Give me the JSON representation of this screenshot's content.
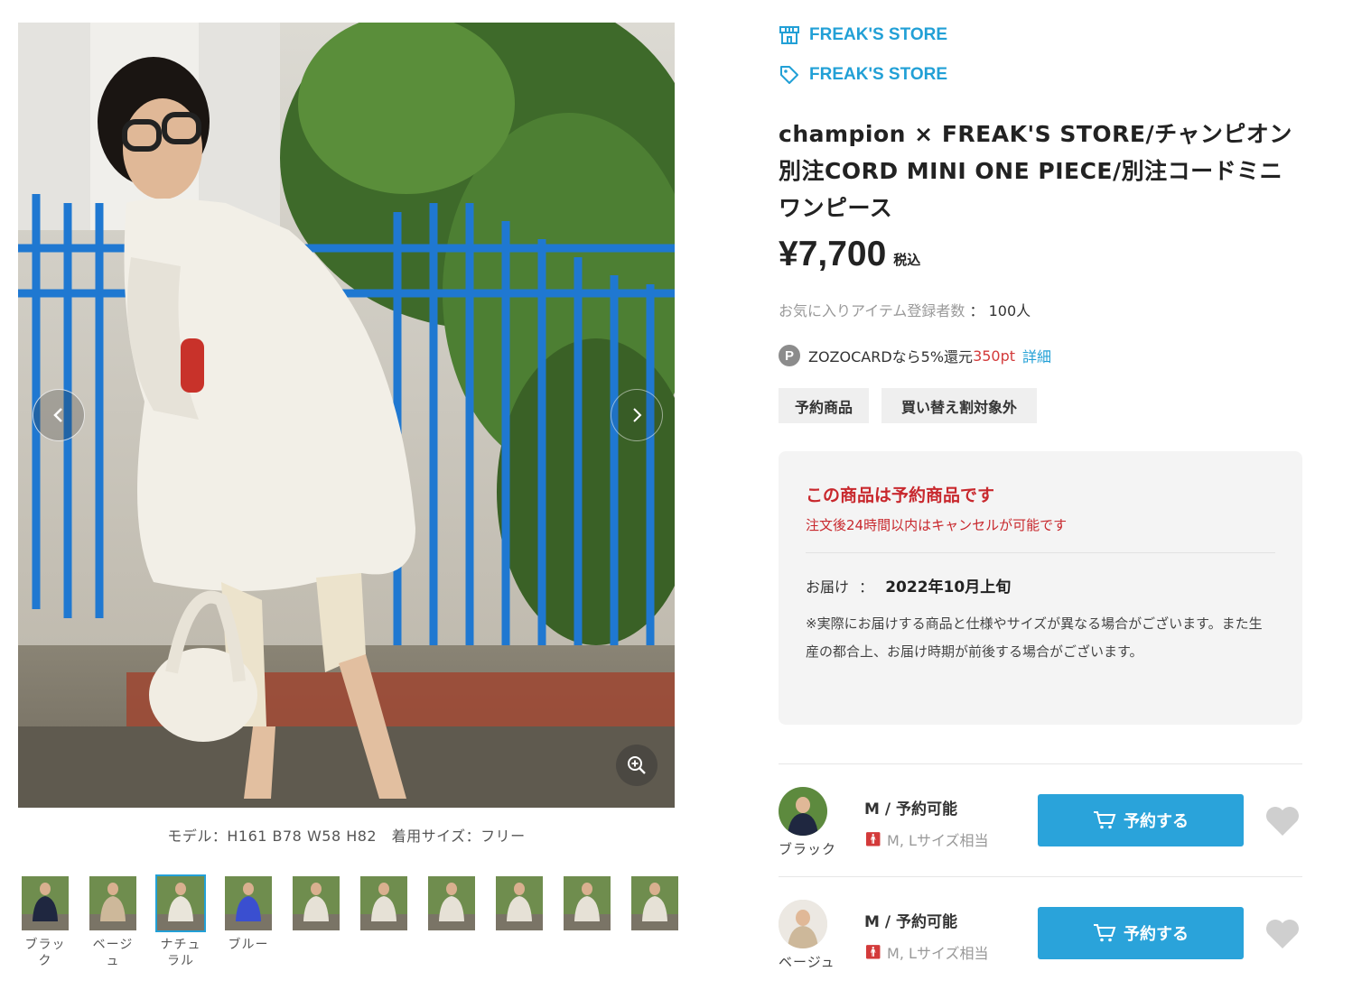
{
  "gallery": {
    "model_info": "モデル：H161 B78 W58 H82　着用サイズ：フリー",
    "thumbnails": [
      {
        "caption": "ブラッ\nク",
        "color": "#1f2740"
      },
      {
        "caption": "ベージ\nュ",
        "color": "#cdb89a"
      },
      {
        "caption": "ナチュ\nラル",
        "color": "#e9e5da"
      },
      {
        "caption": "ブルー",
        "color": "#3a4fd0"
      },
      {
        "caption": "",
        "color": "#e6e1d6"
      },
      {
        "caption": "",
        "color": "#e6e1d6"
      },
      {
        "caption": "",
        "color": "#e6e1d6"
      },
      {
        "caption": "",
        "color": "#e6e1d6"
      },
      {
        "caption": "",
        "color": "#e6e1d6"
      },
      {
        "caption": "",
        "color": "#e6e1d6"
      }
    ]
  },
  "shop": {
    "shop_name": "FREAK'S STORE",
    "brand_name": "FREAK'S STORE"
  },
  "product": {
    "title": "champion × FREAK'S STORE/チャンピオン 別注CORD MINI ONE PIECE/別注コードミニワンピース",
    "price": "¥7,700",
    "tax_label": "税込",
    "fav_label": "お気に入りアイテム登録者数",
    "fav_sep": "：",
    "fav_count": "100人",
    "zozo_text": "ZOZOCARDなら5%還元",
    "zozo_points": "350pt",
    "zozo_detail": "詳細",
    "tags": [
      "予約商品",
      "買い替え割対象外"
    ]
  },
  "notice": {
    "heading": "この商品は予約商品です",
    "cancel_text": "注文後24時間以内はキャンセルが可能です",
    "delivery_label": "お届け",
    "delivery_sep": "：",
    "delivery_date": "2022年10月上旬",
    "note": "※実際にお届けする商品と仕様やサイズが異なる場合がございます。また生産の都合上、お届け時期が前後する場合がございます。"
  },
  "variants": [
    {
      "color_name": "ブラック",
      "size_status": "M / 予約可能",
      "fit": "M, Lサイズ相当",
      "button_label": "予約する",
      "swatch_color": "#1f2740"
    },
    {
      "color_name": "ベージュ",
      "size_status": "M / 予約可能",
      "fit": "M, Lサイズ相当",
      "button_label": "予約する",
      "swatch_color": "#cdb89a"
    }
  ],
  "colors": {
    "accent": "#22a0d6",
    "button": "#2aa3da",
    "alert": "#c8282d"
  }
}
